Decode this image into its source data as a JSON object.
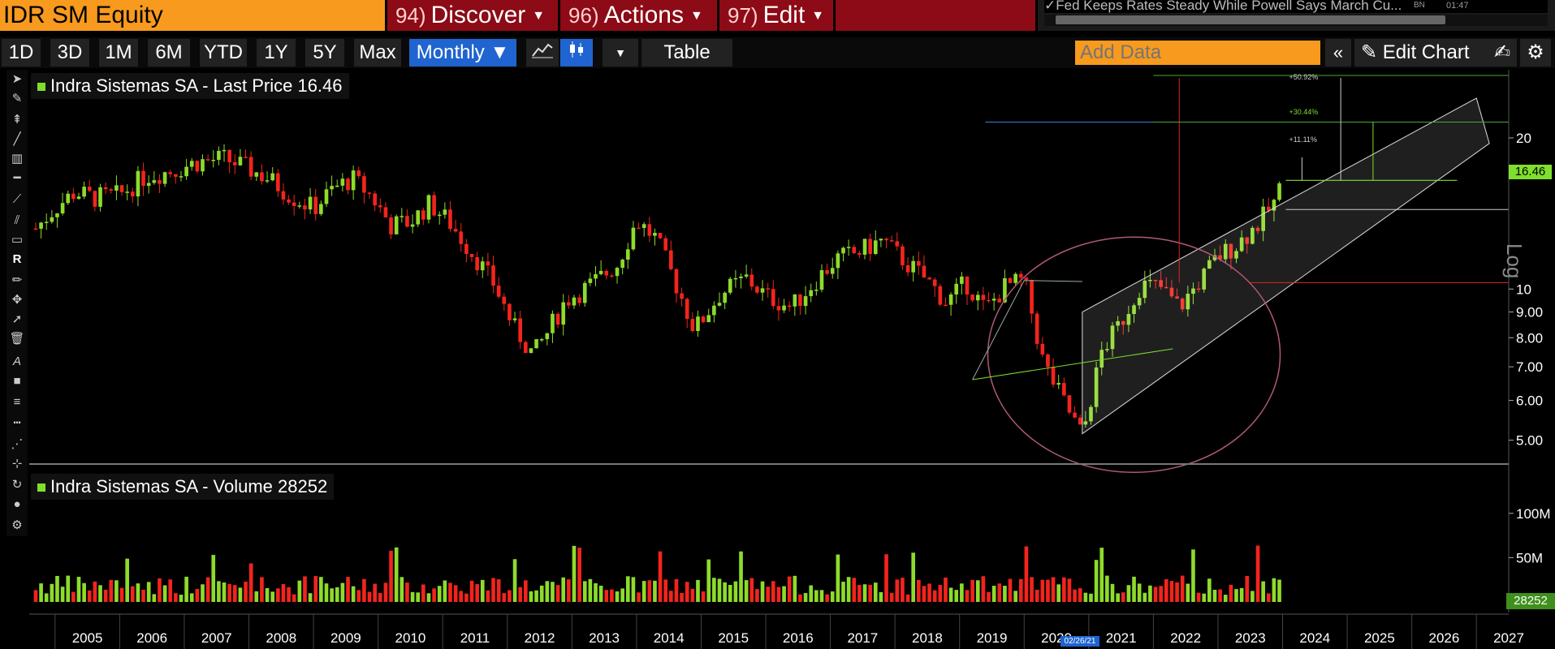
{
  "header": {
    "ticker": "IDR SM Equity",
    "menus": [
      {
        "num": "94)",
        "label": "Discover"
      },
      {
        "num": "96)",
        "label": "Actions"
      },
      {
        "num": "97)",
        "label": "Edit"
      }
    ],
    "news": "✓Fed Keeps Rates Steady While Powell Says March Cu...",
    "news_src": "BN",
    "news_time": "01:47"
  },
  "toolbar": {
    "ranges": [
      "1D",
      "3D",
      "1M",
      "6M",
      "YTD",
      "1Y",
      "5Y",
      "Max"
    ],
    "period": "Monthly ▼",
    "table": "Table",
    "add_data_placeholder": "Add Data",
    "edit_chart": "Edit Chart"
  },
  "colors": {
    "up": "#8edb2b",
    "down": "#f2241d",
    "accent_orange": "#f79a1e",
    "menu_red": "#8c0b16",
    "active_blue": "#1f64d0"
  },
  "price_panel": {
    "legend": "Indra Sistemas SA - Last Price 16.46",
    "scale": "Log",
    "last_tag": "16.46",
    "level_labels": [
      "+50.92%",
      "+30.44%",
      "+11.11%"
    ]
  },
  "volume_panel": {
    "legend": "Indra Sistemas SA - Volume 28252",
    "last_tag": "28252"
  },
  "cursor_date": "02/26/21",
  "chart_data": [
    {
      "type": "line",
      "title": "Indra Sistemas SA - Last Price 16.46",
      "ylabel": "Log",
      "yscale": "log",
      "ylim": [
        4.6,
        25
      ],
      "yticks": [
        "20",
        "10",
        "9.00",
        "8.00",
        "7.00",
        "6.00",
        "5.00"
      ],
      "x_ticks": [
        "2005",
        "2006",
        "2007",
        "2008",
        "2009",
        "2010",
        "2011",
        "2012",
        "2013",
        "2014",
        "2015",
        "2016",
        "2017",
        "2018",
        "2019",
        "2020",
        "2021",
        "2022",
        "2023",
        "2024",
        "2025",
        "2026",
        "2027"
      ],
      "xlim": [
        2004.6,
        2027.5
      ],
      "series": [
        {
          "name": "Last Price",
          "x": [
            2004.7,
            2005.0,
            2005.3,
            2005.6,
            2006.0,
            2006.4,
            2006.8,
            2007.2,
            2007.6,
            2007.9,
            2008.3,
            2008.7,
            2009.0,
            2009.3,
            2009.6,
            2009.9,
            2010.2,
            2010.5,
            2010.8,
            2011.1,
            2011.5,
            2011.8,
            2012.1,
            2012.4,
            2012.6,
            2012.9,
            2013.3,
            2013.7,
            2014.0,
            2014.3,
            2014.6,
            2014.9,
            2015.3,
            2015.7,
            2016.0,
            2016.4,
            2016.8,
            2017.1,
            2017.4,
            2017.8,
            2018.2,
            2018.5,
            2018.8,
            2019.1,
            2019.4,
            2019.7,
            2020.0,
            2020.3,
            2020.6,
            2020.9,
            2021.2,
            2021.5,
            2021.8,
            2022.1,
            2022.4,
            2022.7,
            2023.0,
            2023.3,
            2023.6,
            2023.9,
            2024.0
          ],
          "values": [
            13.2,
            14.5,
            15.6,
            15.2,
            15.4,
            16.8,
            17.2,
            17.9,
            18.2,
            17.6,
            16.6,
            15.2,
            14.5,
            15.8,
            16.6,
            15.3,
            13.4,
            13.6,
            14.8,
            13.6,
            11.6,
            10.2,
            8.4,
            7.4,
            8.1,
            9.5,
            10.2,
            11.2,
            13.7,
            12.6,
            10.3,
            8.3,
            9.8,
            10.5,
            9.7,
            9.2,
            10.5,
            11.5,
            11.8,
            12.5,
            11.2,
            10.4,
            9.4,
            10.3,
            9.1,
            10.1,
            10.4,
            7.1,
            6.0,
            5.1,
            7.5,
            8.6,
            10.2,
            10.1,
            9.2,
            10.3,
            11.6,
            12.3,
            13.4,
            15.0,
            16.46
          ]
        }
      ],
      "annotations": [
        "+50.92%",
        "+30.44%",
        "+11.11%"
      ]
    },
    {
      "type": "bar",
      "title": "Indra Sistemas SA - Volume 28252",
      "yticks": [
        "100M",
        "50M"
      ],
      "ylim": [
        0,
        130000000
      ],
      "last_value": 28252
    }
  ]
}
